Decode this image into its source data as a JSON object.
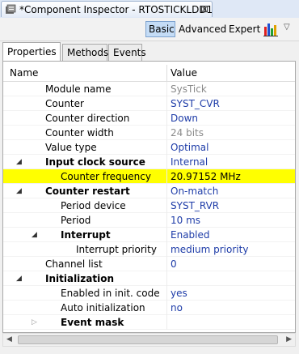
{
  "window": {
    "title": "*Component Inspector - RTOSTICKLDD1",
    "close_glyph": "⊠"
  },
  "toolbar": {
    "basic": "Basic",
    "advanced": "Advanced",
    "expert": "Expert",
    "menu_glyph": "▽"
  },
  "tabs": [
    {
      "label": "Properties",
      "active": true
    },
    {
      "label": "Methods",
      "active": false
    },
    {
      "label": "Events",
      "active": false
    }
  ],
  "table": {
    "col_name": "Name",
    "col_value": "Value",
    "rows": [
      {
        "name": "Module name",
        "value": "SysTick",
        "value_style": "gray",
        "level": 2,
        "bold": false,
        "twisty": ""
      },
      {
        "name": "Counter",
        "value": "SYST_CVR",
        "value_style": "blue",
        "level": 2,
        "bold": false,
        "twisty": ""
      },
      {
        "name": "Counter direction",
        "value": "Down",
        "value_style": "blue",
        "level": 2,
        "bold": false,
        "twisty": ""
      },
      {
        "name": "Counter width",
        "value": "24 bits",
        "value_style": "gray",
        "level": 2,
        "bold": false,
        "twisty": ""
      },
      {
        "name": "Value type",
        "value": "Optimal",
        "value_style": "blue",
        "level": 2,
        "bold": false,
        "twisty": ""
      },
      {
        "name": "Input clock source",
        "value": "Internal",
        "value_style": "blue",
        "level": 2,
        "bold": true,
        "twisty": "◢"
      },
      {
        "name": "Counter frequency",
        "value": "20.97152 MHz",
        "value_style": "black",
        "level": 3,
        "bold": false,
        "twisty": "",
        "highlight": true
      },
      {
        "name": "Counter restart",
        "value": "On-match",
        "value_style": "blue",
        "level": 2,
        "bold": true,
        "twisty": "◢"
      },
      {
        "name": "Period device",
        "value": "SYST_RVR",
        "value_style": "blue",
        "level": 3,
        "bold": false,
        "twisty": ""
      },
      {
        "name": "Period",
        "value": "10 ms",
        "value_style": "blue",
        "level": 3,
        "bold": false,
        "twisty": ""
      },
      {
        "name": "Interrupt",
        "value": "Enabled",
        "value_style": "blue",
        "level": 3,
        "bold": true,
        "twisty": "◢"
      },
      {
        "name": "Interrupt priority",
        "value": "medium priority",
        "value_style": "blue",
        "level": 4,
        "bold": false,
        "twisty": ""
      },
      {
        "name": "Channel list",
        "value": "0",
        "value_style": "blue",
        "level": 2,
        "bold": false,
        "twisty": ""
      },
      {
        "name": "Initialization",
        "value": "",
        "value_style": "blue",
        "level": 2,
        "bold": true,
        "twisty": "◢"
      },
      {
        "name": "Enabled in init. code",
        "value": "yes",
        "value_style": "blue",
        "level": 3,
        "bold": false,
        "twisty": ""
      },
      {
        "name": "Auto initialization",
        "value": "no",
        "value_style": "blue",
        "level": 3,
        "bold": false,
        "twisty": ""
      },
      {
        "name": "Event mask",
        "value": "",
        "value_style": "blue",
        "level": 3,
        "bold": true,
        "twisty": "▷"
      }
    ]
  },
  "scrollbar": {
    "left_glyph": "◀",
    "right_glyph": "▶"
  }
}
